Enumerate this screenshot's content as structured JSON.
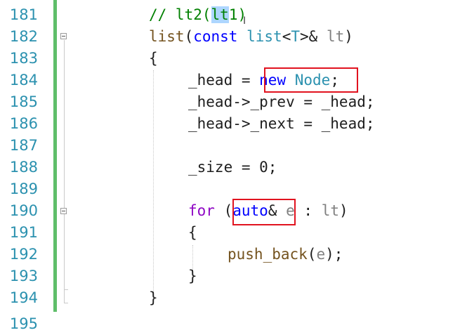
{
  "editor": {
    "lines": [
      {
        "num": "181",
        "tokens": [
          {
            "t": "// lt2(",
            "c": "cm"
          },
          {
            "t": "lt",
            "c": "cm sel"
          },
          {
            "t": "1)",
            "c": "cm"
          }
        ]
      },
      {
        "num": "182",
        "tokens": [
          {
            "t": "list",
            "c": "fn"
          },
          {
            "t": "(",
            "c": ""
          },
          {
            "t": "const",
            "c": "kw"
          },
          {
            "t": " ",
            "c": ""
          },
          {
            "t": "list",
            "c": "ty"
          },
          {
            "t": "<",
            "c": ""
          },
          {
            "t": "T",
            "c": "ty"
          },
          {
            "t": ">& ",
            "c": ""
          },
          {
            "t": "lt",
            "c": "pm"
          },
          {
            "t": ")",
            "c": ""
          }
        ]
      },
      {
        "num": "183",
        "tokens": [
          {
            "t": "{",
            "c": ""
          }
        ]
      },
      {
        "num": "184",
        "tokens": [
          {
            "t": "_head = ",
            "c": ""
          },
          {
            "t": "new",
            "c": "kw"
          },
          {
            "t": " ",
            "c": ""
          },
          {
            "t": "Node",
            "c": "ty"
          },
          {
            "t": ";",
            "c": ""
          }
        ]
      },
      {
        "num": "185",
        "tokens": [
          {
            "t": "_head->_prev = _head;",
            "c": ""
          }
        ]
      },
      {
        "num": "186",
        "tokens": [
          {
            "t": "_head->_next = _head;",
            "c": ""
          }
        ]
      },
      {
        "num": "187",
        "tokens": []
      },
      {
        "num": "188",
        "tokens": [
          {
            "t": "_size = 0;",
            "c": ""
          }
        ]
      },
      {
        "num": "189",
        "tokens": []
      },
      {
        "num": "190",
        "tokens": [
          {
            "t": "for",
            "c": "kw2"
          },
          {
            "t": " (",
            "c": ""
          },
          {
            "t": "auto",
            "c": "kw"
          },
          {
            "t": "& ",
            "c": ""
          },
          {
            "t": "e",
            "c": "pm"
          },
          {
            "t": " : ",
            "c": ""
          },
          {
            "t": "lt",
            "c": "pm"
          },
          {
            "t": ")",
            "c": ""
          }
        ]
      },
      {
        "num": "191",
        "tokens": [
          {
            "t": "{",
            "c": ""
          }
        ]
      },
      {
        "num": "192",
        "tokens": [
          {
            "t": "push_back",
            "c": "fn"
          },
          {
            "t": "(",
            "c": ""
          },
          {
            "t": "e",
            "c": "pm"
          },
          {
            "t": ");",
            "c": ""
          }
        ]
      },
      {
        "num": "193",
        "tokens": [
          {
            "t": "}",
            "c": ""
          }
        ]
      },
      {
        "num": "194",
        "tokens": [
          {
            "t": "}",
            "c": ""
          }
        ]
      }
    ],
    "partial_line_number": "195",
    "cursor_glyph": "I",
    "highlights": [
      "new Node;",
      "auto&"
    ]
  },
  "colors": {
    "keyword": "#0000ff",
    "control_keyword": "#8f08c4",
    "type": "#2b91af",
    "parameter": "#808080",
    "function": "#74531f",
    "comment": "#008000",
    "line_number": "#2b91af",
    "change_bar": "#5fbe6a",
    "annotation_box": "#e1131f"
  }
}
